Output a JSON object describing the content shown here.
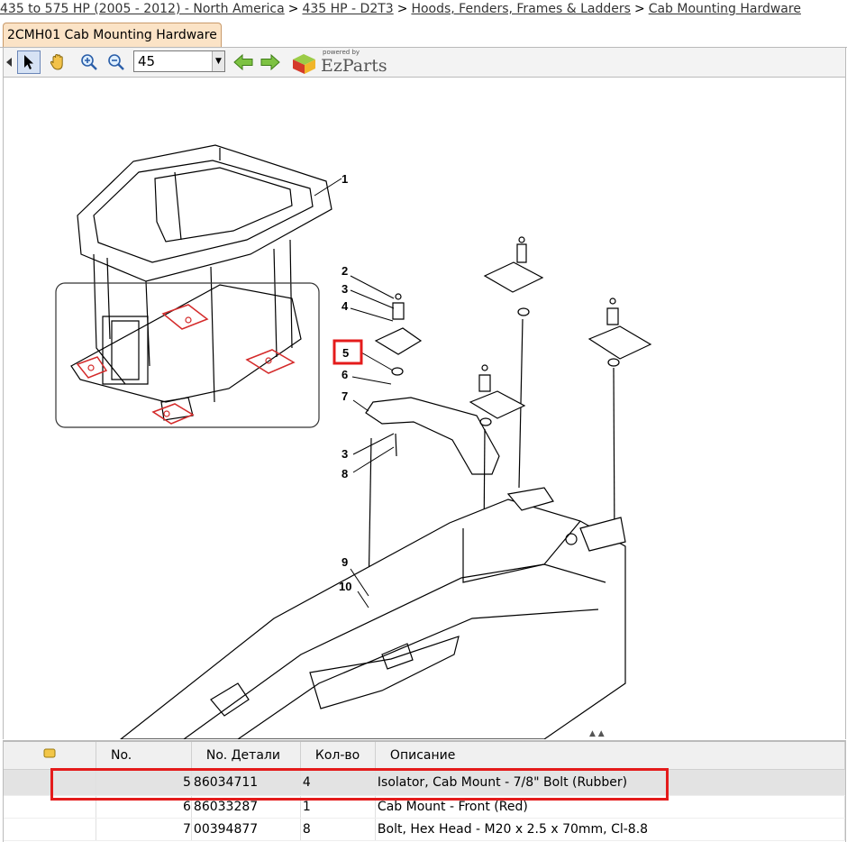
{
  "breadcrumb": {
    "items": [
      "435 to 575 HP (2005 - 2012) - North America",
      "435 HP - D2T3",
      "Hoods, Fenders, Frames & Ladders",
      "Cab Mounting Hardware"
    ],
    "separator": ">"
  },
  "tab": {
    "label": "2CMH01 Cab Mounting Hardware"
  },
  "toolbar": {
    "zoom_value": "45",
    "logo_powered": "powered by",
    "logo_name": "EzParts"
  },
  "callouts": [
    "1",
    "2",
    "3",
    "4",
    "5",
    "6",
    "7",
    "3",
    "8",
    "9",
    "10"
  ],
  "table": {
    "columns": [
      "No.",
      "No. Детали",
      "Кол-во",
      "Описание"
    ],
    "rows": [
      {
        "no": "5",
        "part": "86034711",
        "qty": "4",
        "desc": "Isolator, Cab Mount - 7/8\" Bolt (Rubber)",
        "selected": true
      },
      {
        "no": "6",
        "part": "86033287",
        "qty": "1",
        "desc": "Cab Mount - Front (Red)",
        "selected": false
      },
      {
        "no": "7",
        "part": "00394877",
        "qty": "8",
        "desc": "Bolt, Hex Head - M20 x 2.5 x 70mm, Cl-8.8",
        "selected": false
      }
    ]
  },
  "colors": {
    "highlight": "#e41b1b",
    "tab_bg": "#fbe3c6",
    "selected_row": "#e3e3e3"
  }
}
